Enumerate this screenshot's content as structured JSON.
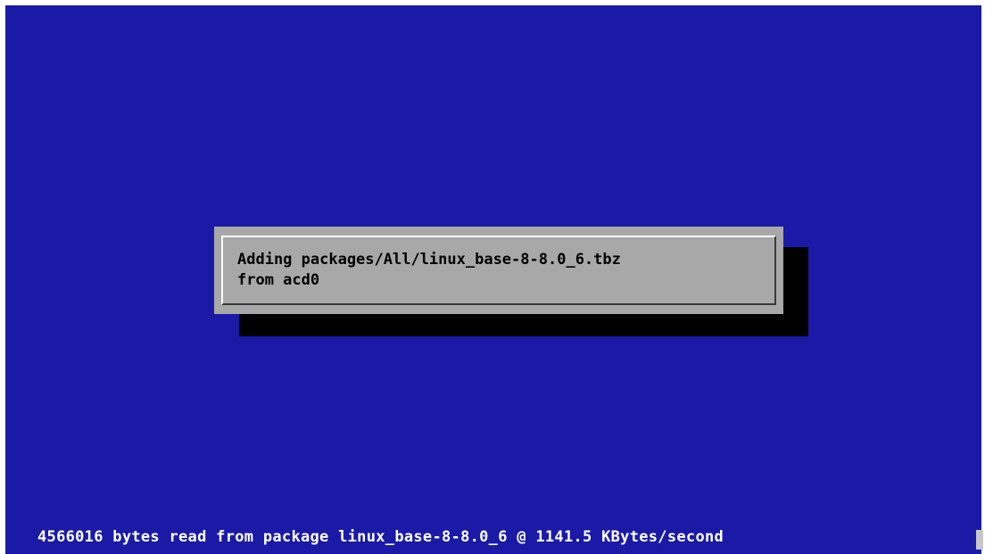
{
  "dialog": {
    "line1": "Adding packages/All/linux_base-8-8.0_6.tbz",
    "line2": "from acd0"
  },
  "status": {
    "text": "4566016 bytes read from package linux_base-8-8.0_6 @ 1141.5 KBytes/second"
  },
  "colors": {
    "screen_background": "#1a1aa6",
    "dialog_background": "#a8a8a8",
    "dialog_shadow": "#000000",
    "status_text": "#ffffff"
  }
}
